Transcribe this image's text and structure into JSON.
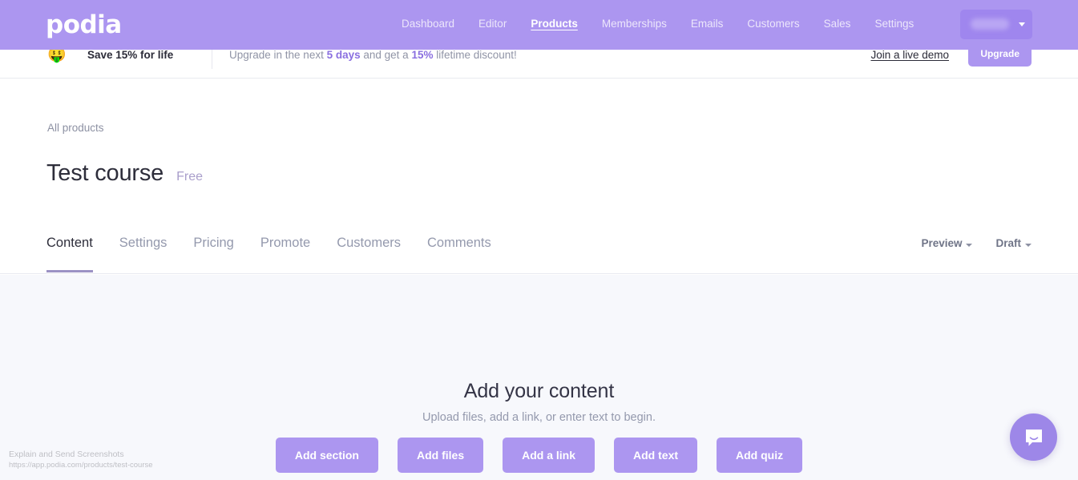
{
  "brand": {
    "logo_text": "podia",
    "accent": "#ac96f0",
    "nav_bg": "#ac96f0"
  },
  "topnav": {
    "links": [
      {
        "label": "Dashboard",
        "active": false
      },
      {
        "label": "Editor",
        "active": false
      },
      {
        "label": "Products",
        "active": true
      },
      {
        "label": "Memberships",
        "active": false
      },
      {
        "label": "Emails",
        "active": false
      },
      {
        "label": "Customers",
        "active": false
      },
      {
        "label": "Sales",
        "active": false
      },
      {
        "label": "Settings",
        "active": false
      }
    ],
    "account": {
      "label": "",
      "caret": "chevron-down-icon"
    }
  },
  "promo_banner": {
    "emoji": "🤑",
    "headline": "Save 15% for life",
    "message_prefix": "Upgrade in the next ",
    "message_highlight_1": "5 days",
    "message_middle": " and get a ",
    "message_highlight_2": "15%",
    "message_suffix": " lifetime discount!",
    "demo_link": "Join a live demo",
    "upgrade_button": "Upgrade"
  },
  "page": {
    "breadcrumb": "All products",
    "title": "Test course",
    "price_badge": "Free"
  },
  "tabs": [
    {
      "label": "Content",
      "active": true
    },
    {
      "label": "Settings",
      "active": false
    },
    {
      "label": "Pricing",
      "active": false
    },
    {
      "label": "Promote",
      "active": false
    },
    {
      "label": "Customers",
      "active": false
    },
    {
      "label": "Comments",
      "active": false
    }
  ],
  "head_actions": [
    {
      "label": "Preview"
    },
    {
      "label": "Draft"
    }
  ],
  "empty_state": {
    "title": "Add your content",
    "subtitle": "Upload files, add a link, or enter text to begin.",
    "buttons": [
      "Add section",
      "Add files",
      "Add a link",
      "Add text",
      "Add quiz"
    ]
  },
  "chat": {
    "icon": "chat-bubble-icon",
    "color": "#9d87e8"
  },
  "watermark": {
    "line1": "Explain and Send Screenshots",
    "line2": "https://app.podia.com/products/test-course"
  }
}
